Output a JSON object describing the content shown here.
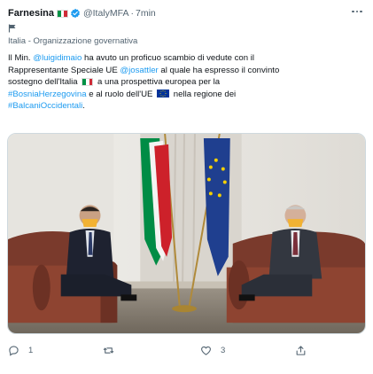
{
  "tweet": {
    "author_name": "Farnesina",
    "handle": "@ItalyMFA",
    "separator": "·",
    "time": "7min",
    "label": "Italia - Organizzazione governativa",
    "text": {
      "l1_a": "Il Min. ",
      "l1_link": "@luigidimaio",
      "l1_b": " ha avuto un proficuo scambio di vedute con il",
      "l2_a": "Rappresentante Speciale UE ",
      "l2_link": "@josattler",
      "l2_b": " al quale ha espresso il convinto",
      "l3_a": "sostegno dell'Italia",
      "l3_b": "a una prospettiva europea per la",
      "l4_link": "#BosniaHerzegovina",
      "l4_a": " e al ruolo dell'UE",
      "l4_b": "nella regione dei",
      "l5_link": "#BalcaniOccidentali",
      "l5_a": "."
    },
    "actions": {
      "reply_count": "1",
      "retweet_count": "",
      "like_count": "3",
      "share_count": ""
    },
    "icons": {
      "verified": "verified-badge-icon",
      "more": "more-options-icon",
      "label": "flag-icon",
      "reply": "reply-icon",
      "retweet": "retweet-icon",
      "like": "like-icon",
      "share": "share-icon"
    },
    "colors": {
      "link": "#1d9bf0",
      "secondary_text": "#536471",
      "italy_green": "#009246",
      "italy_white": "#ffffff",
      "italy_red": "#ce2b37",
      "eu_blue": "#003399",
      "eu_star": "#ffcc00"
    }
  }
}
